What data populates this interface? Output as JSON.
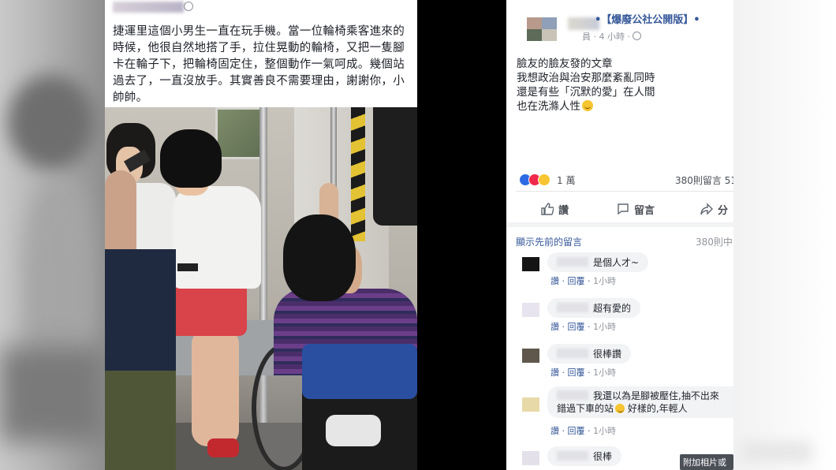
{
  "source_post": {
    "text": "捷運里這個小男生一直在玩手機。當一位輪椅乘客進來的\n時候，他很自然地搭了手，拉住晃動的輪椅，又把一隻腳\n卡在輪子下，把輪椅固定住，整個動作一氣呵成。幾個站\n過去了，一直沒放手。其實善良不需要理由，謝謝你，小\n帥帥。"
  },
  "fb_post": {
    "page_name": "•【爆廢公社公開版】•",
    "meta": "員 · 4 小時 ·",
    "body": "臉友的臉友發的文章\n我想政治與治安那麼紊亂同時\n還是有些「沉默的愛」在人間\n也在洗滌人性",
    "reaction_count": "1 萬",
    "comment_count": "380則留言  51",
    "actions": {
      "like": "讚",
      "comment": "留言",
      "share": "分"
    },
    "show_previous": "顯示先前的留言",
    "previous_count": "380則中",
    "comment_meta": {
      "like": "讚",
      "sep": " · ",
      "reply": "回覆",
      "time": "1小時"
    },
    "comments": [
      {
        "text": "是個人才~"
      },
      {
        "text": "超有愛的"
      },
      {
        "text": "很棒讚"
      },
      {
        "text_line1": "我還以為是腳被壓住,抽不出來",
        "text_line2": "錯過下車的站",
        "text_line2_end": "好樣的,年輕人"
      },
      {
        "text": "很棒"
      }
    ],
    "photo_tooltip": "附加相片或"
  },
  "colors": {
    "fb_blue": "#365899",
    "like_blue": "#2d6be4",
    "love_red": "#f0284a",
    "haha_yellow": "#f7c531",
    "meta_gray": "#90949c"
  },
  "icons": [
    "globe-icon",
    "like-icon",
    "comment-icon",
    "share-icon",
    "smile-emoji-icon"
  ]
}
